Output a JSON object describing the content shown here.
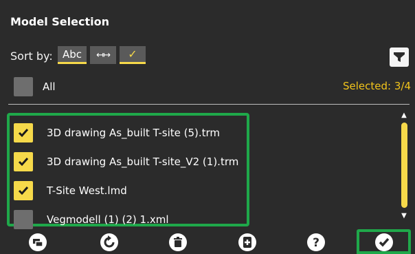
{
  "header": {
    "title": "Model Selection"
  },
  "sort": {
    "label": "Sort by:",
    "options": [
      {
        "label": "Abc",
        "active": true
      },
      {
        "label": "↤↦",
        "active": false
      },
      {
        "label": "✓",
        "active": true
      }
    ]
  },
  "filter": {
    "icon": "filter-icon"
  },
  "select_all": {
    "label": "All",
    "checked": false
  },
  "selected": {
    "text": "Selected: 3/4"
  },
  "models": [
    {
      "name": "3D drawing As_built T-site (5).trm",
      "checked": true
    },
    {
      "name": "3D drawing As_built T-site_V2 (1).trm",
      "checked": true
    },
    {
      "name": "T-Site West.lmd",
      "checked": true
    },
    {
      "name": "Vegmodell (1) (2) 1.xml",
      "checked": false
    }
  ],
  "toolbar": {
    "buttons": [
      "import-icon",
      "refresh-icon",
      "delete-icon",
      "add-icon",
      "help-icon",
      "confirm-icon"
    ]
  },
  "colors": {
    "accent": "#f6d94a",
    "highlight": "#1fa84a",
    "background": "#2b2b2b",
    "selected_text": "#f3c51b"
  }
}
